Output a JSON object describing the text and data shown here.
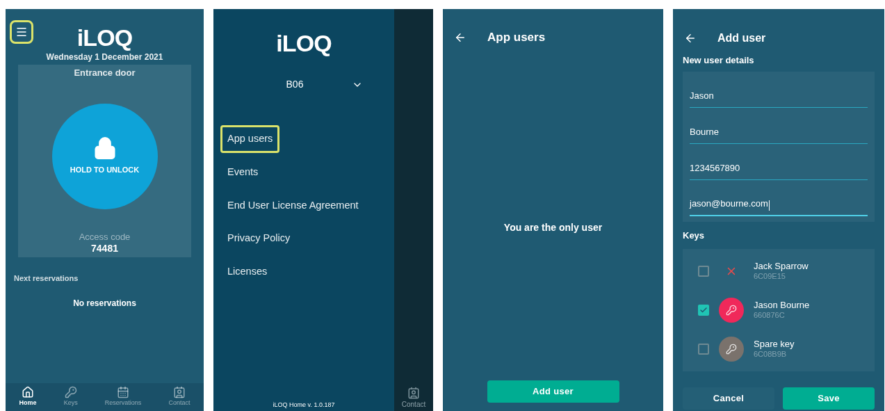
{
  "home": {
    "menu_highlighted": true,
    "logo": "iLOQ",
    "date": "Wednesday 1 December 2021",
    "door": "Entrance door",
    "unlock_label": "HOLD TO UNLOCK",
    "access_label": "Access code",
    "access_code": "74481",
    "reservations_title": "Next reservations",
    "reservations_empty": "No reservations",
    "nav": [
      {
        "kind": "home",
        "label": "Home",
        "selected": true
      },
      {
        "kind": "keys",
        "label": "Keys",
        "selected": false
      },
      {
        "kind": "calendar",
        "label": "Reservations",
        "selected": false
      },
      {
        "kind": "contact",
        "label": "Contact",
        "selected": false
      }
    ]
  },
  "drawer": {
    "logo": "iLOQ",
    "site": "B06",
    "items": [
      {
        "label": "App users",
        "highlighted": true
      },
      {
        "label": "Events",
        "highlighted": false
      },
      {
        "label": "End User License Agreement",
        "highlighted": false
      },
      {
        "label": "Privacy Policy",
        "highlighted": false
      },
      {
        "label": "Licenses",
        "highlighted": false
      }
    ],
    "version": "iLOQ Home v. 1.0.187",
    "behind_label": "Contact"
  },
  "app_users": {
    "title": "App users",
    "empty": "You are the only user",
    "button": "Add user"
  },
  "add_user": {
    "title": "Add user",
    "details_title": "New user details",
    "fields": [
      {
        "value": "Jason",
        "focused": false
      },
      {
        "value": "Bourne",
        "focused": false
      },
      {
        "value": "1234567890",
        "focused": false
      },
      {
        "value": "jason@bourne.com",
        "focused": true
      }
    ],
    "keys_title": "Keys",
    "keys": [
      {
        "kind": "invalid",
        "name": "Jack Sparrow",
        "code": "6C09E15",
        "checked": false
      },
      {
        "kind": "key",
        "name": "Jason Bourne",
        "code": "660876C",
        "checked": true,
        "color": "#f0285a"
      },
      {
        "kind": "key",
        "name": "Spare key",
        "code": "6C08B9B",
        "checked": false,
        "color": "#7a726c"
      }
    ],
    "cancel": "Cancel",
    "save": "Save"
  }
}
